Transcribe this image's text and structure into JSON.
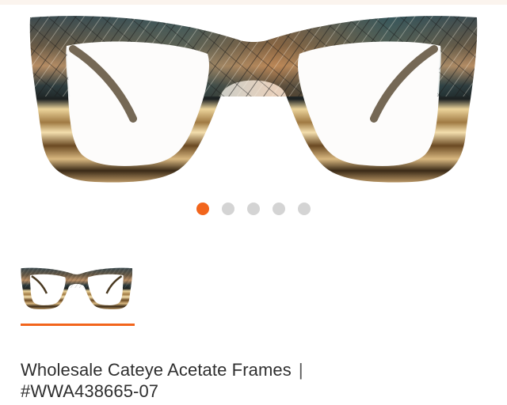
{
  "product": {
    "name": "Wholesale Cateye Acetate Frames",
    "separator": "|",
    "sku": "#WWA438665-07"
  },
  "gallery": {
    "total_slides": 5,
    "active_index": 0,
    "accent_color": "#f2651c",
    "inactive_dot_color": "#d4d4d4"
  },
  "thumbnails": [
    {
      "image": "cateye-glasses-front-image",
      "selected": true
    }
  ]
}
